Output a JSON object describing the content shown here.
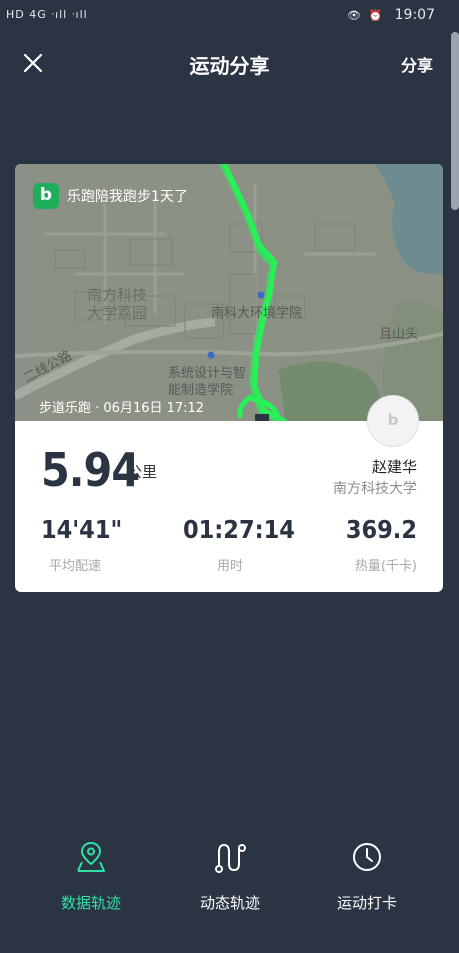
{
  "status_bar": {
    "left_text": "HD 4G ᐧıll ᐧıll",
    "right_icons": "👁 ⏰",
    "time": "19:07"
  },
  "header": {
    "title": "运动分享",
    "share_label": "分享"
  },
  "card": {
    "brand_letter": "b",
    "brand_text": "乐跑陪我跑步1天了",
    "map_labels": {
      "campus": "南方科技\n大学荔园",
      "env_school": "南科大环境学院",
      "design_school": "系统设计与智\n能制造学院",
      "mountain": "且山头",
      "road": "二线公路"
    },
    "caption": "步道乐跑 · 06月16日 17:12",
    "distance": "5.94",
    "distance_unit": "公里",
    "user_name": "赵建华",
    "user_school": "南方科技大学",
    "stats": [
      {
        "value": "14'41\"",
        "label": "平均配速"
      },
      {
        "value": "01:27:14",
        "label": "用时"
      },
      {
        "value": "369.2",
        "label": "热量(千卡)"
      }
    ],
    "colors": {
      "route": "#25f255",
      "brand": "#1fae5b"
    }
  },
  "bottom_nav": [
    {
      "label": "数据轨迹",
      "icon": "map-pin-icon",
      "active": true
    },
    {
      "label": "动态轨迹",
      "icon": "route-icon",
      "active": false
    },
    {
      "label": "运动打卡",
      "icon": "clock-icon",
      "active": false
    }
  ]
}
